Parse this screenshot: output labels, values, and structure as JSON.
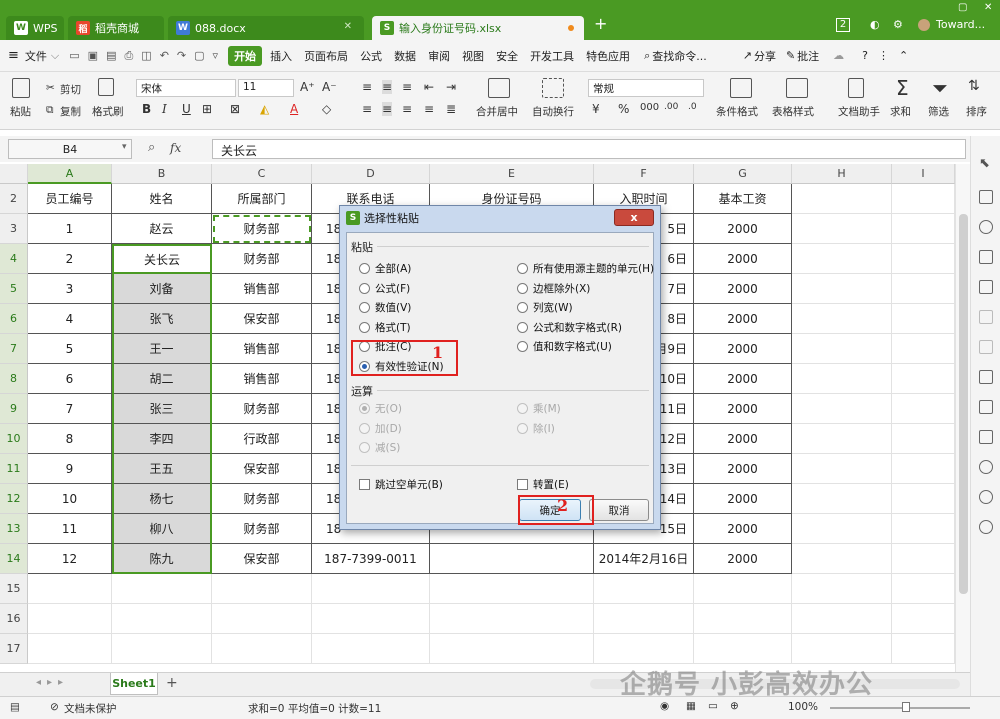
{
  "titlebar": {
    "tabs": [
      {
        "label": "WPS",
        "icon": "wps-logo-icon"
      },
      {
        "label": "稻壳商城",
        "icon": "docer-icon"
      },
      {
        "label": "088.docx",
        "icon": "word-doc-icon"
      },
      {
        "label": "输入身份证号码.xlsx",
        "icon": "spreadsheet-icon"
      }
    ],
    "new_tab": "+",
    "badge": "2",
    "user": "Toward..."
  },
  "menu": {
    "file": "文件",
    "start": "开始",
    "items": [
      "插入",
      "页面布局",
      "公式",
      "数据",
      "审阅",
      "视图",
      "安全",
      "开发工具",
      "特色应用"
    ],
    "search": "查找命令...",
    "share": "分享",
    "comment": "批注"
  },
  "ribbon": {
    "paste": "粘贴",
    "cut": "剪切",
    "copy": "复制",
    "format_painter": "格式刷",
    "font": "宋体",
    "font_size": "11",
    "merge": "合并居中",
    "wrap": "自动换行",
    "number_format": "常规",
    "cond_format": "条件格式",
    "table_style": "表格样式",
    "doc_helper": "文档助手",
    "sum": "求和",
    "filter": "筛选",
    "sort": "排序"
  },
  "formula_bar": {
    "name_box": "B4",
    "fx": "fx",
    "value": "关长云"
  },
  "columns": [
    "A",
    "B",
    "C",
    "D",
    "E",
    "F",
    "G",
    "H",
    "I"
  ],
  "header_row": [
    "员工编号",
    "姓名",
    "所属部门",
    "联系电话",
    "身份证号码",
    "入职时间",
    "基本工资"
  ],
  "rows": [
    {
      "num": "2"
    },
    {
      "num": "3",
      "cells": [
        "1",
        "赵云",
        "财务部",
        "18",
        "",
        "5日",
        "2000"
      ]
    },
    {
      "num": "4",
      "cells": [
        "2",
        "关长云",
        "财务部",
        "18",
        "",
        "6日",
        "2000"
      ]
    },
    {
      "num": "5",
      "cells": [
        "3",
        "刘备",
        "销售部",
        "18",
        "",
        "7日",
        "2000"
      ]
    },
    {
      "num": "6",
      "cells": [
        "4",
        "张飞",
        "保安部",
        "18",
        "",
        "8日",
        "2000"
      ]
    },
    {
      "num": "7",
      "cells": [
        "5",
        "王一",
        "销售部",
        "18",
        "",
        "月9日",
        "2000"
      ]
    },
    {
      "num": "8",
      "cells": [
        "6",
        "胡二",
        "销售部",
        "18",
        "",
        "10日",
        "2000"
      ]
    },
    {
      "num": "9",
      "cells": [
        "7",
        "张三",
        "财务部",
        "18",
        "",
        "11日",
        "2000"
      ]
    },
    {
      "num": "10",
      "cells": [
        "8",
        "李四",
        "行政部",
        "18",
        "",
        "12日",
        "2000"
      ]
    },
    {
      "num": "11",
      "cells": [
        "9",
        "王五",
        "保安部",
        "18",
        "",
        "13日",
        "2000"
      ]
    },
    {
      "num": "12",
      "cells": [
        "10",
        "杨七",
        "财务部",
        "18",
        "",
        "14日",
        "2000"
      ]
    },
    {
      "num": "13",
      "cells": [
        "11",
        "柳八",
        "财务部",
        "18",
        "",
        "15日",
        "2000"
      ]
    },
    {
      "num": "14",
      "cells": [
        "12",
        "陈九",
        "保安部",
        "187-7399-0011",
        "",
        "2014年2月16日",
        "2000"
      ]
    },
    {
      "num": "15"
    },
    {
      "num": "16"
    },
    {
      "num": "17"
    }
  ],
  "sheet": {
    "name": "Sheet1",
    "add": "+"
  },
  "status": {
    "protect": "文档未保护",
    "stats": "求和=0  平均值=0  计数=11",
    "zoom": "100%"
  },
  "dialog": {
    "title": "选择性粘贴",
    "close": "x",
    "paste_group": "粘贴",
    "paste_left": [
      "全部(A)",
      "公式(F)",
      "数值(V)",
      "格式(T)",
      "批注(C)",
      "有效性验证(N)"
    ],
    "paste_right": [
      "所有使用源主题的单元(H)",
      "边框除外(X)",
      "列宽(W)",
      "公式和数字格式(R)",
      "值和数字格式(U)"
    ],
    "op_group": "运算",
    "op_left": [
      "无(O)",
      "加(D)",
      "减(S)"
    ],
    "op_right": [
      "乘(M)",
      "除(I)"
    ],
    "skip_blanks": "跳过空单元(B)",
    "transpose": "转置(E)",
    "ok": "确定",
    "cancel": "取消",
    "marker1": "1",
    "marker2": "2"
  },
  "watermark": "企鹅号 小彭高效办公"
}
